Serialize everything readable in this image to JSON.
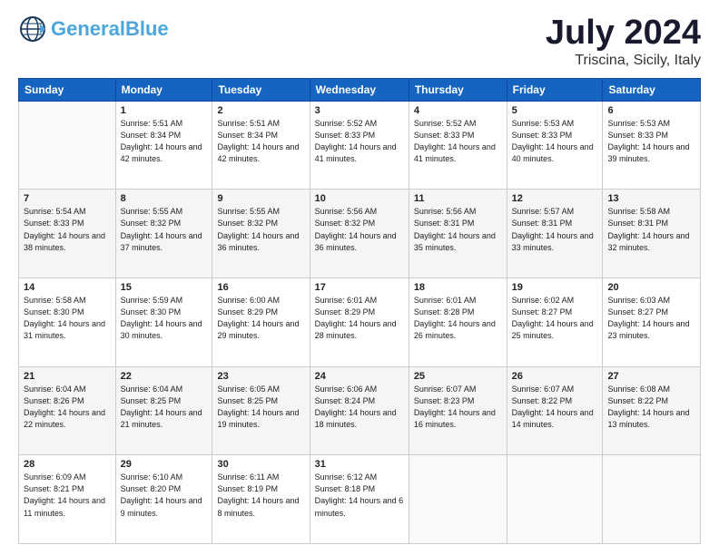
{
  "header": {
    "logo_general": "General",
    "logo_blue": "Blue",
    "month_title": "July 2024",
    "location": "Triscina, Sicily, Italy"
  },
  "days_of_week": [
    "Sunday",
    "Monday",
    "Tuesday",
    "Wednesday",
    "Thursday",
    "Friday",
    "Saturday"
  ],
  "weeks": [
    [
      {
        "day": "",
        "sunrise": "",
        "sunset": "",
        "daylight": ""
      },
      {
        "day": "1",
        "sunrise": "Sunrise: 5:51 AM",
        "sunset": "Sunset: 8:34 PM",
        "daylight": "Daylight: 14 hours and 42 minutes."
      },
      {
        "day": "2",
        "sunrise": "Sunrise: 5:51 AM",
        "sunset": "Sunset: 8:34 PM",
        "daylight": "Daylight: 14 hours and 42 minutes."
      },
      {
        "day": "3",
        "sunrise": "Sunrise: 5:52 AM",
        "sunset": "Sunset: 8:33 PM",
        "daylight": "Daylight: 14 hours and 41 minutes."
      },
      {
        "day": "4",
        "sunrise": "Sunrise: 5:52 AM",
        "sunset": "Sunset: 8:33 PM",
        "daylight": "Daylight: 14 hours and 41 minutes."
      },
      {
        "day": "5",
        "sunrise": "Sunrise: 5:53 AM",
        "sunset": "Sunset: 8:33 PM",
        "daylight": "Daylight: 14 hours and 40 minutes."
      },
      {
        "day": "6",
        "sunrise": "Sunrise: 5:53 AM",
        "sunset": "Sunset: 8:33 PM",
        "daylight": "Daylight: 14 hours and 39 minutes."
      }
    ],
    [
      {
        "day": "7",
        "sunrise": "Sunrise: 5:54 AM",
        "sunset": "Sunset: 8:33 PM",
        "daylight": "Daylight: 14 hours and 38 minutes."
      },
      {
        "day": "8",
        "sunrise": "Sunrise: 5:55 AM",
        "sunset": "Sunset: 8:32 PM",
        "daylight": "Daylight: 14 hours and 37 minutes."
      },
      {
        "day": "9",
        "sunrise": "Sunrise: 5:55 AM",
        "sunset": "Sunset: 8:32 PM",
        "daylight": "Daylight: 14 hours and 36 minutes."
      },
      {
        "day": "10",
        "sunrise": "Sunrise: 5:56 AM",
        "sunset": "Sunset: 8:32 PM",
        "daylight": "Daylight: 14 hours and 36 minutes."
      },
      {
        "day": "11",
        "sunrise": "Sunrise: 5:56 AM",
        "sunset": "Sunset: 8:31 PM",
        "daylight": "Daylight: 14 hours and 35 minutes."
      },
      {
        "day": "12",
        "sunrise": "Sunrise: 5:57 AM",
        "sunset": "Sunset: 8:31 PM",
        "daylight": "Daylight: 14 hours and 33 minutes."
      },
      {
        "day": "13",
        "sunrise": "Sunrise: 5:58 AM",
        "sunset": "Sunset: 8:31 PM",
        "daylight": "Daylight: 14 hours and 32 minutes."
      }
    ],
    [
      {
        "day": "14",
        "sunrise": "Sunrise: 5:58 AM",
        "sunset": "Sunset: 8:30 PM",
        "daylight": "Daylight: 14 hours and 31 minutes."
      },
      {
        "day": "15",
        "sunrise": "Sunrise: 5:59 AM",
        "sunset": "Sunset: 8:30 PM",
        "daylight": "Daylight: 14 hours and 30 minutes."
      },
      {
        "day": "16",
        "sunrise": "Sunrise: 6:00 AM",
        "sunset": "Sunset: 8:29 PM",
        "daylight": "Daylight: 14 hours and 29 minutes."
      },
      {
        "day": "17",
        "sunrise": "Sunrise: 6:01 AM",
        "sunset": "Sunset: 8:29 PM",
        "daylight": "Daylight: 14 hours and 28 minutes."
      },
      {
        "day": "18",
        "sunrise": "Sunrise: 6:01 AM",
        "sunset": "Sunset: 8:28 PM",
        "daylight": "Daylight: 14 hours and 26 minutes."
      },
      {
        "day": "19",
        "sunrise": "Sunrise: 6:02 AM",
        "sunset": "Sunset: 8:27 PM",
        "daylight": "Daylight: 14 hours and 25 minutes."
      },
      {
        "day": "20",
        "sunrise": "Sunrise: 6:03 AM",
        "sunset": "Sunset: 8:27 PM",
        "daylight": "Daylight: 14 hours and 23 minutes."
      }
    ],
    [
      {
        "day": "21",
        "sunrise": "Sunrise: 6:04 AM",
        "sunset": "Sunset: 8:26 PM",
        "daylight": "Daylight: 14 hours and 22 minutes."
      },
      {
        "day": "22",
        "sunrise": "Sunrise: 6:04 AM",
        "sunset": "Sunset: 8:25 PM",
        "daylight": "Daylight: 14 hours and 21 minutes."
      },
      {
        "day": "23",
        "sunrise": "Sunrise: 6:05 AM",
        "sunset": "Sunset: 8:25 PM",
        "daylight": "Daylight: 14 hours and 19 minutes."
      },
      {
        "day": "24",
        "sunrise": "Sunrise: 6:06 AM",
        "sunset": "Sunset: 8:24 PM",
        "daylight": "Daylight: 14 hours and 18 minutes."
      },
      {
        "day": "25",
        "sunrise": "Sunrise: 6:07 AM",
        "sunset": "Sunset: 8:23 PM",
        "daylight": "Daylight: 14 hours and 16 minutes."
      },
      {
        "day": "26",
        "sunrise": "Sunrise: 6:07 AM",
        "sunset": "Sunset: 8:22 PM",
        "daylight": "Daylight: 14 hours and 14 minutes."
      },
      {
        "day": "27",
        "sunrise": "Sunrise: 6:08 AM",
        "sunset": "Sunset: 8:22 PM",
        "daylight": "Daylight: 14 hours and 13 minutes."
      }
    ],
    [
      {
        "day": "28",
        "sunrise": "Sunrise: 6:09 AM",
        "sunset": "Sunset: 8:21 PM",
        "daylight": "Daylight: 14 hours and 11 minutes."
      },
      {
        "day": "29",
        "sunrise": "Sunrise: 6:10 AM",
        "sunset": "Sunset: 8:20 PM",
        "daylight": "Daylight: 14 hours and 9 minutes."
      },
      {
        "day": "30",
        "sunrise": "Sunrise: 6:11 AM",
        "sunset": "Sunset: 8:19 PM",
        "daylight": "Daylight: 14 hours and 8 minutes."
      },
      {
        "day": "31",
        "sunrise": "Sunrise: 6:12 AM",
        "sunset": "Sunset: 8:18 PM",
        "daylight": "Daylight: 14 hours and 6 minutes."
      },
      {
        "day": "",
        "sunrise": "",
        "sunset": "",
        "daylight": ""
      },
      {
        "day": "",
        "sunrise": "",
        "sunset": "",
        "daylight": ""
      },
      {
        "day": "",
        "sunrise": "",
        "sunset": "",
        "daylight": ""
      }
    ]
  ]
}
